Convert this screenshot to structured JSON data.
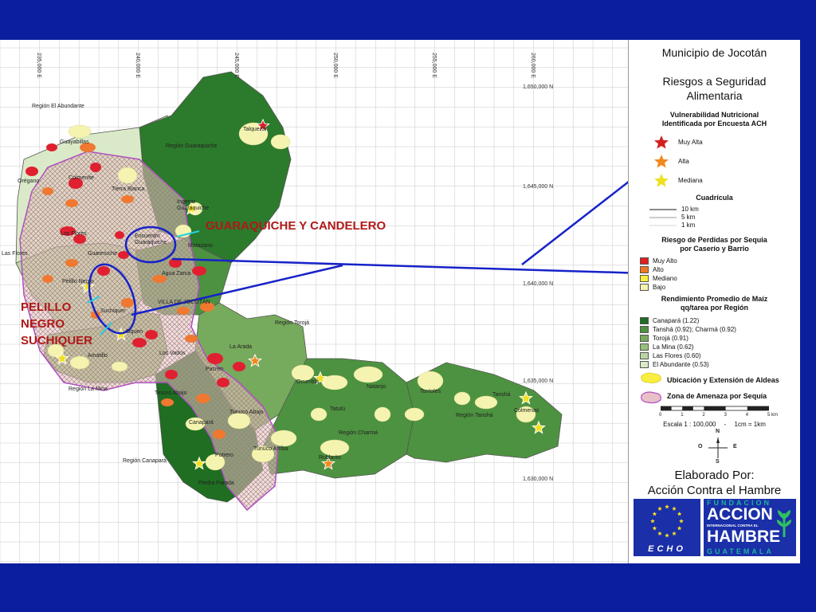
{
  "legend": {
    "title1": "Municipio de Jocotán",
    "title2a": "Riesgos a Seguridad",
    "title2b": "Alimentaria",
    "vuln_h1": "Vulnerabilidad Nutricional",
    "vuln_h2": "Identificada por Encuesta ACH",
    "vuln_items": [
      "Muy Alta",
      "Alta",
      "Mediana"
    ],
    "vuln_colors": [
      "#d42020",
      "#f08a20",
      "#f0e020"
    ],
    "grid_h": "Cuadrícula",
    "grid_items": [
      "10 km",
      "5 km",
      "1 km"
    ],
    "risk_h1": "Riesgo de Perdidas por Sequia",
    "risk_h2": "por Caserío y Barrio",
    "risk_items": [
      "Muy Alto",
      "Alto",
      "Mediano",
      "Bajo"
    ],
    "risk_colors": [
      "#e02020",
      "#f07820",
      "#f8ee40",
      "#f4f4b0"
    ],
    "yield_h1": "Rendimiento Promedio de Maíz",
    "yield_h2": "qq/tarea por Región",
    "yield_items": [
      "Canapará (1.22)",
      "Tanshá (0.92); Charmá (0.92)",
      "Torojá (0.91)",
      "La Mina (0.62)",
      "Las Flores (0.60)",
      "El Abundante (0.53)"
    ],
    "yield_colors": [
      "#1f6e22",
      "#4d9240",
      "#76aa5c",
      "#98c07c",
      "#bad6a2",
      "#daeac8"
    ],
    "aldeas_label": "Ubicación y Extensión de Aldeas",
    "amenaza_label": "Zona de Amenaza por Sequía",
    "scale_ticks": [
      "0",
      "1",
      "2",
      "3",
      "4",
      "5 km"
    ],
    "scale_text_a": "Escala 1 : 100,000",
    "scale_text_b": "-",
    "scale_text_c": "1cm = 1km",
    "compass": [
      "N",
      "O",
      "E",
      "S"
    ],
    "elaborado_a": "Elaborado Por:",
    "elaborado_b": "Acción Contra el Hambre",
    "echo_label": "ECHO",
    "fund_top": "FUNDACION",
    "fund_main1": "ACCION",
    "fund_mid": "INTERNACIONAL CONTRA EL",
    "fund_main2": "HAMBRE",
    "fund_bottom": "GUATEMALA"
  },
  "coords_e": [
    "235,000 E",
    "240,000 E",
    "245,000 E",
    "250,000 E",
    "255,000 E",
    "260,000 E"
  ],
  "coords_n": [
    "1,650,000 N",
    "1,645,000 N",
    "1,640,000 N",
    "1,635,000 N",
    "1,630,000 N"
  ],
  "callouts": {
    "guaraquiche": "GUARAQUICHE Y CANDELERO",
    "pelillo": [
      "PELILLO",
      "NEGRO",
      "SUCHIQUER"
    ]
  },
  "regions": {
    "abundante": "Región El Abundante",
    "guaraquiche": "Región Guaraquiche",
    "las_flores": "Las Flores",
    "la_mina": "Región La Mina",
    "canapara": "Región Canapará",
    "toroja": "Región Torojá",
    "charma": "Región Charmá",
    "tansha": "Región Tanshá"
  },
  "places": {
    "talquezal": "Talquezal",
    "guayabillas": "Guayabillas",
    "oregano": "Orégano",
    "colmenas_w": "Colmeníte",
    "tierra_blanca": "Tierra Blanca",
    "ingenio": "Ingenio Guaraquiche",
    "encuentro": "Encuentro Guaraquiche",
    "matazano": "Matazano",
    "los_flores": "Los Flores",
    "guareruche": "Guareruche",
    "pelillo": "Pelillo Negro",
    "agua_zarca": "Agua Zarca",
    "suchiquer": "Suchiquer",
    "villa": "VILLA DE JOCOTÁN",
    "oquen": "Oquen",
    "amatillo": "Amatillo",
    "los_vados": "Los Vados",
    "la_arada": "La Arada",
    "pacren": "Pacren",
    "tesoro": "Tesoro Abajo",
    "tunuco_abajo": "Tunuco Abajo",
    "canapara": "Canapará",
    "tunuco_arriba": "Tunuco Arriba",
    "matasano2": "Potrero",
    "piedra": "Piedra Parada",
    "oquimbla": "Ocumblá",
    "tatutu": "Tatutú",
    "natanjo": "Natanjo",
    "tontoles": "Tontoles",
    "tansha": "Tanshá",
    "colmenas": "Colmenas",
    "roblarito": "Roblarito"
  }
}
